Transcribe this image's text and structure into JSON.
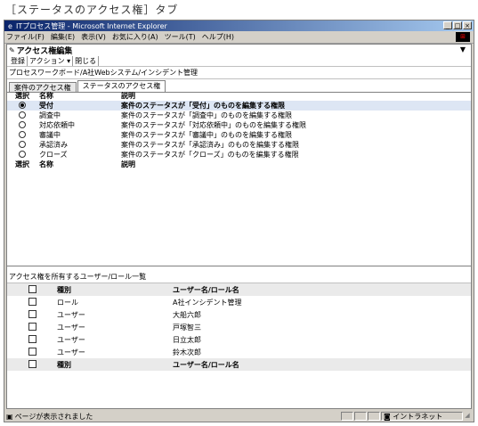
{
  "caption": "［ステータスのアクセス権］タブ",
  "window": {
    "title": "ITプロセス管理 - Microsoft Internet Explorer",
    "controls": {
      "minimize": "_",
      "maximize": "□",
      "close": "×"
    }
  },
  "menu": [
    "ファイル(F)",
    "編集(E)",
    "表示(V)",
    "お気に入り(A)",
    "ツール(T)",
    "ヘルプ(H)"
  ],
  "pane": {
    "title": "アクセス権編集"
  },
  "toolbar": {
    "register": "登録",
    "action": "アクション ▾",
    "close": "閉じる"
  },
  "breadcrumb": "プロセスワークボード/A社Webシステム/インシデント管理",
  "tabs": [
    {
      "label": "案件のアクセス権",
      "active": false
    },
    {
      "label": "ステータスのアクセス権",
      "active": true
    }
  ],
  "status_table": {
    "header": {
      "select": "選択",
      "name": "名称",
      "desc": "説明"
    },
    "rows": [
      {
        "selected": true,
        "name": "受付",
        "desc": "案件のステータスが「受付」のものを編集する権限"
      },
      {
        "selected": false,
        "name": "調査中",
        "desc": "案件のステータスが「調査中」のものを編集する権限"
      },
      {
        "selected": false,
        "name": "対応依頼中",
        "desc": "案件のステータスが「対応依頼中」のものを編集する権限"
      },
      {
        "selected": false,
        "name": "審議中",
        "desc": "案件のステータスが「審議中」のものを編集する権限"
      },
      {
        "selected": false,
        "name": "承認済み",
        "desc": "案件のステータスが「承認済み」のものを編集する権限"
      },
      {
        "selected": false,
        "name": "クローズ",
        "desc": "案件のステータスが「クローズ」のものを編集する権限"
      }
    ],
    "footer": {
      "select": "選択",
      "name": "名称",
      "desc": "説明"
    }
  },
  "user_list": {
    "title": "アクセス権を所有するユーザー/ロール一覧",
    "header": {
      "kind": "種別",
      "name": "ユーザー名/ロール名"
    },
    "rows": [
      {
        "kind": "ロール",
        "name": "A社インシデント管理"
      },
      {
        "kind": "ユーザー",
        "name": "大船六郎"
      },
      {
        "kind": "ユーザー",
        "name": "戸塚智三"
      },
      {
        "kind": "ユーザー",
        "name": "日立太郎"
      },
      {
        "kind": "ユーザー",
        "name": "鈴木次郎"
      }
    ],
    "footer": {
      "kind": "種別",
      "name": "ユーザー名/ロール名"
    }
  },
  "statusbar": {
    "text": "ページが表示されました",
    "zone": "イントラネット"
  }
}
